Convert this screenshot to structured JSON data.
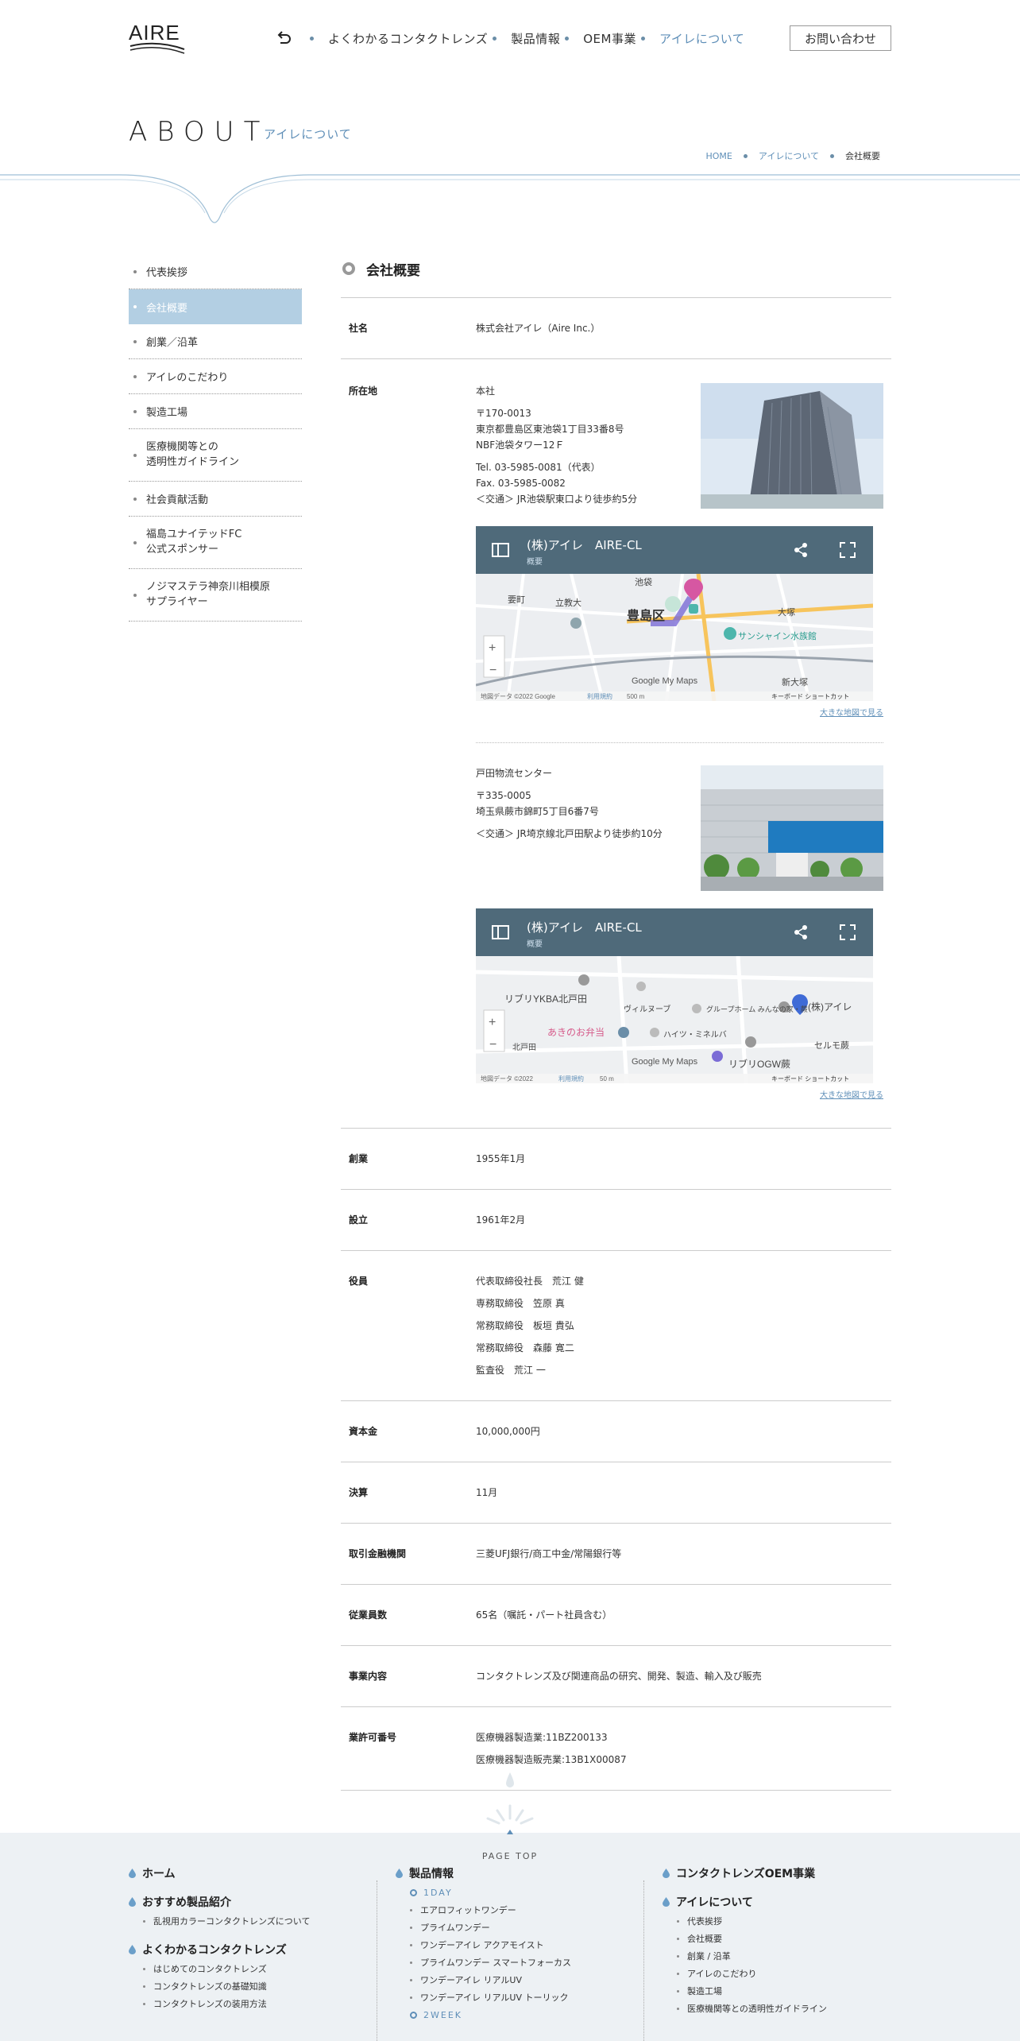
{
  "header": {
    "logo_text": "AIRE",
    "nav": [
      "よくわかるコンタクトレンズ",
      "製品情報",
      "OEM事業",
      "アイレについて"
    ],
    "contact": "お問い合わせ"
  },
  "title": {
    "main": "ABOUT",
    "sub": "アイレについて"
  },
  "breadcrumb": [
    "HOME",
    "アイレについて",
    "会社概要"
  ],
  "sidebar": {
    "items": [
      "代表挨拶",
      "会社概要",
      "創業／沿革",
      "アイレのこだわり",
      "製造工場",
      "医療機関等との\n透明性ガイドライン",
      "社会貢献活動",
      "福島ユナイテッドFC\n公式スポンサー",
      "ノジマステラ神奈川相模原\nサプライヤー"
    ]
  },
  "section_title": "会社概要",
  "table": {
    "company_label": "社名",
    "company_value": "株式会社アイレ（Aire Inc.）",
    "address_label": "所在地",
    "hq": {
      "name": "本社",
      "zip": "〒170-0013",
      "addr1": "東京都豊島区東池袋1丁目33番8号",
      "addr2": "NBF池袋タワー12Ｆ",
      "tel": "Tel. 03-5985-0081（代表）",
      "fax": "Fax. 03-5985-0082",
      "access": "＜交通＞ JR池袋駅東口より徒歩約5分"
    },
    "map1": {
      "title": "(株)アイレ　AIRE-CL",
      "sub": "概要",
      "labels": [
        "池袋",
        "豊島区",
        "サンシャイン水族館",
        "大塚",
        "新大塚",
        "立教大",
        "要町",
        "Google My Maps",
        "地図データ ©2022 Google",
        "利用規約",
        "500 m",
        "キーボード ショートカット"
      ]
    },
    "bigmap1": "大きな地図で見る",
    "dc": {
      "name": "戸田物流センター",
      "zip": "〒335-0005",
      "addr": "埼玉県蕨市錦町5丁目6番7号",
      "access": "＜交通＞ JR埼京線北戸田駅より徒歩約10分"
    },
    "map2": {
      "title": "(株)アイレ　AIRE-CL",
      "sub": "概要",
      "labels": [
        "リブリYKBA北戸田",
        "ヴィルヌーブ",
        "グループホーム みんなの家・蕨",
        "あきのお弁当",
        "ハイツ・ミネルバ",
        "リブリOGW蕨",
        "セルモ蕨",
        "(株)アイレ",
        "北戸田",
        "Google My Maps",
        "地図データ ©2022",
        "利用規約",
        "50 m",
        "キーボード ショートカット"
      ]
    },
    "bigmap2": "大きな地図で見る",
    "founded_label": "創業",
    "founded_value": "1955年1月",
    "established_label": "設立",
    "established_value": "1961年2月",
    "officers_label": "役員",
    "officers": [
      "代表取締役社長　荒江 健",
      "専務取締役　笠原 真",
      "常務取締役　板垣 貴弘",
      "常務取締役　森藤 寛二",
      "監査役　荒江 一"
    ],
    "capital_label": "資本金",
    "capital_value": "10,000,000円",
    "closing_label": "決算",
    "closing_value": "11月",
    "banks_label": "取引金融機関",
    "banks_value": "三菱UFJ銀行/商工中金/常陽銀行等",
    "employees_label": "従業員数",
    "employees_value": "65名（嘱託・パート社員含む）",
    "business_label": "事業内容",
    "business_value": "コンタクトレンズ及び関連商品の研究、開発、製造、輸入及び販売",
    "license_label": "業許可番号",
    "license1": "医療機器製造業:11BZ200133",
    "license2": "医療機器製造販売業:13B1X00087"
  },
  "pagetop": "PAGE TOP",
  "footer": {
    "col1": {
      "home": "ホーム",
      "recommend": "おすすめ製品紹介",
      "recommend_links": [
        "乱視用カラーコンタクトレンズについて"
      ],
      "guide": "よくわかるコンタクトレンズ",
      "guide_links": [
        "はじめてのコンタクトレンズ",
        "コンタクトレンズの基礎知識",
        "コンタクトレンズの装用方法"
      ]
    },
    "col2": {
      "products": "製品情報",
      "cat1": "1DAY",
      "cat1_links": [
        "エアロフィットワンデー",
        "プライムワンデー",
        "ワンデーアイレ アクアモイスト",
        "プライムワンデー スマートフォーカス",
        "ワンデーアイレ リアルUV",
        "ワンデーアイレ リアルUV トーリック"
      ],
      "cat2": "2WEEK"
    },
    "col3": {
      "oem": "コンタクトレンズOEM事業",
      "about": "アイレについて",
      "about_links": [
        "代表挨拶",
        "会社概要",
        "創業 / 沿革",
        "アイレのこだわり",
        "製造工場",
        "医療機関等との透明性ガイドライン"
      ]
    }
  }
}
